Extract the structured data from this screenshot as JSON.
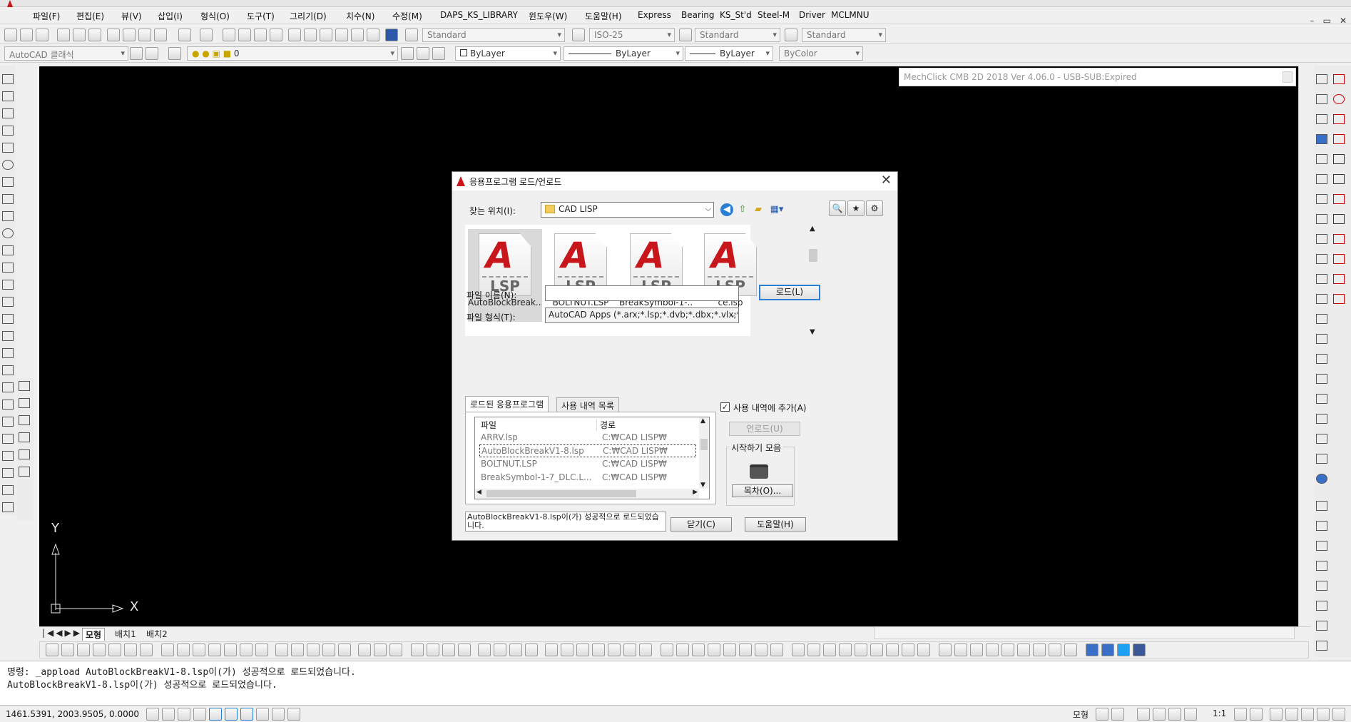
{
  "menu": [
    "파일(F)",
    "편집(E)",
    "뷰(V)",
    "삽입(I)",
    "형식(O)",
    "도구(T)",
    "그리기(D)",
    "치수(N)",
    "수정(M)",
    "DAPS_KS_LIBRARY",
    "윈도우(W)",
    "도움말(H)",
    "Express",
    "Bearing",
    "KS_St'd",
    "Steel-M",
    "Driver",
    "MCLMNU"
  ],
  "window_controls": [
    "–",
    "▭",
    "✕"
  ],
  "toolbar1": {
    "text_style": "Standard",
    "dim_style": "ISO-25",
    "table_style": "Standard",
    "multileader_style": "Standard"
  },
  "toolbar2": {
    "workspace": "AutoCAD 클래식",
    "layer": "0",
    "color": "ByLayer",
    "linetype": "ByLayer",
    "lineweight": "ByLayer",
    "plotstyle": "ByColor"
  },
  "mechclick": "MechClick CMB 2D 2018  Ver 4.06.0 - USB-SUB:Expired",
  "ucs": {
    "y": "Y",
    "x": "X"
  },
  "layout_tabs": [
    "모형",
    "배치1",
    "배치2"
  ],
  "dialog": {
    "title": "응용프로그램 로드/언로드",
    "lookin_label": "찾는 위치(I):",
    "lookin_value": "CAD LISP",
    "file_icon_text": "LSP",
    "files": [
      "AutoBlockBreak...",
      "BOLTNUT.LSP",
      "BreakSymbol-1-...",
      "ce.lsp"
    ],
    "filename_label": "파일 이름(N):",
    "filename_value": "",
    "filetype_label": "파일 형식(T):",
    "filetype_value": "AutoCAD Apps (*.arx;*.lsp;*.dvb;*.dbx;*.vlx;*.fa",
    "load_button": "로드(L)",
    "tab_loaded": "로드된 응용프로그램",
    "tab_history": "사용 내역 목록",
    "col_file": "파일",
    "col_path": "경로",
    "rows": [
      {
        "file": "ARRV.lsp",
        "path": "C:₩CAD LISP₩"
      },
      {
        "file": "AutoBlockBreakV1-8.lsp",
        "path": "C:₩CAD LISP₩"
      },
      {
        "file": "BOLTNUT.LSP",
        "path": "C:₩CAD LISP₩"
      },
      {
        "file": "BreakSymbol-1-7_DLC.L...",
        "path": "C:₩CAD LISP₩"
      }
    ],
    "add_history": "사용 내역에 추가(A)",
    "unload_button": "언로드(U)",
    "startup_label": "시작하기 모음",
    "contents_button": "목차(O)...",
    "status_message": "AutoBlockBreakV1-8.lsp이(가) 성공적으로 로드되었습니다.",
    "close_button": "닫기(C)",
    "help_button": "도움말(H)"
  },
  "command_line": [
    "명령: _appload AutoBlockBreakV1-8.lsp이(가) 성공적으로 로드되었습니다.",
    "AutoBlockBreakV1-8.lsp이(가) 성공적으로 로드되었습니다."
  ],
  "status": {
    "coords": "1461.5391, 2003.9505, 0.0000",
    "model": "모형",
    "scale": "1:1"
  }
}
